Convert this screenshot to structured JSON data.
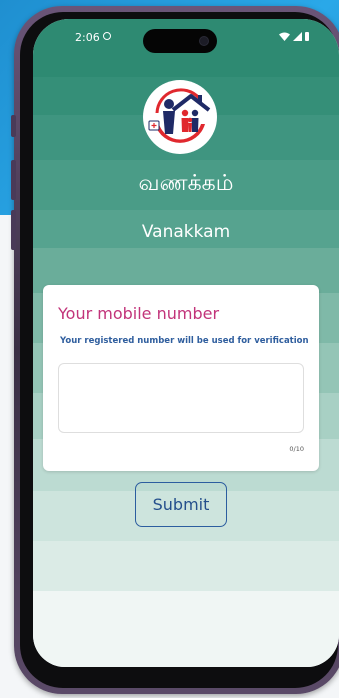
{
  "status_bar": {
    "time": "2:06"
  },
  "greeting": {
    "tamil": "வணக்கம்",
    "english": "Vanakkam"
  },
  "form": {
    "title": "Your mobile number",
    "subtitle": "Your registered number will be used for verification",
    "mobile_value": "",
    "counter": "0/10"
  },
  "actions": {
    "submit_label": "Submit"
  },
  "colors": {
    "title_pink": "#c2347a",
    "accent_blue": "#2c5d9f",
    "band_top": "#2e8a72",
    "band_bottom": "#f0f6f4"
  },
  "icons": {
    "logo": "family-house-logo-icon",
    "status": [
      "cellular-icon",
      "wifi-icon",
      "battery-icon"
    ]
  }
}
